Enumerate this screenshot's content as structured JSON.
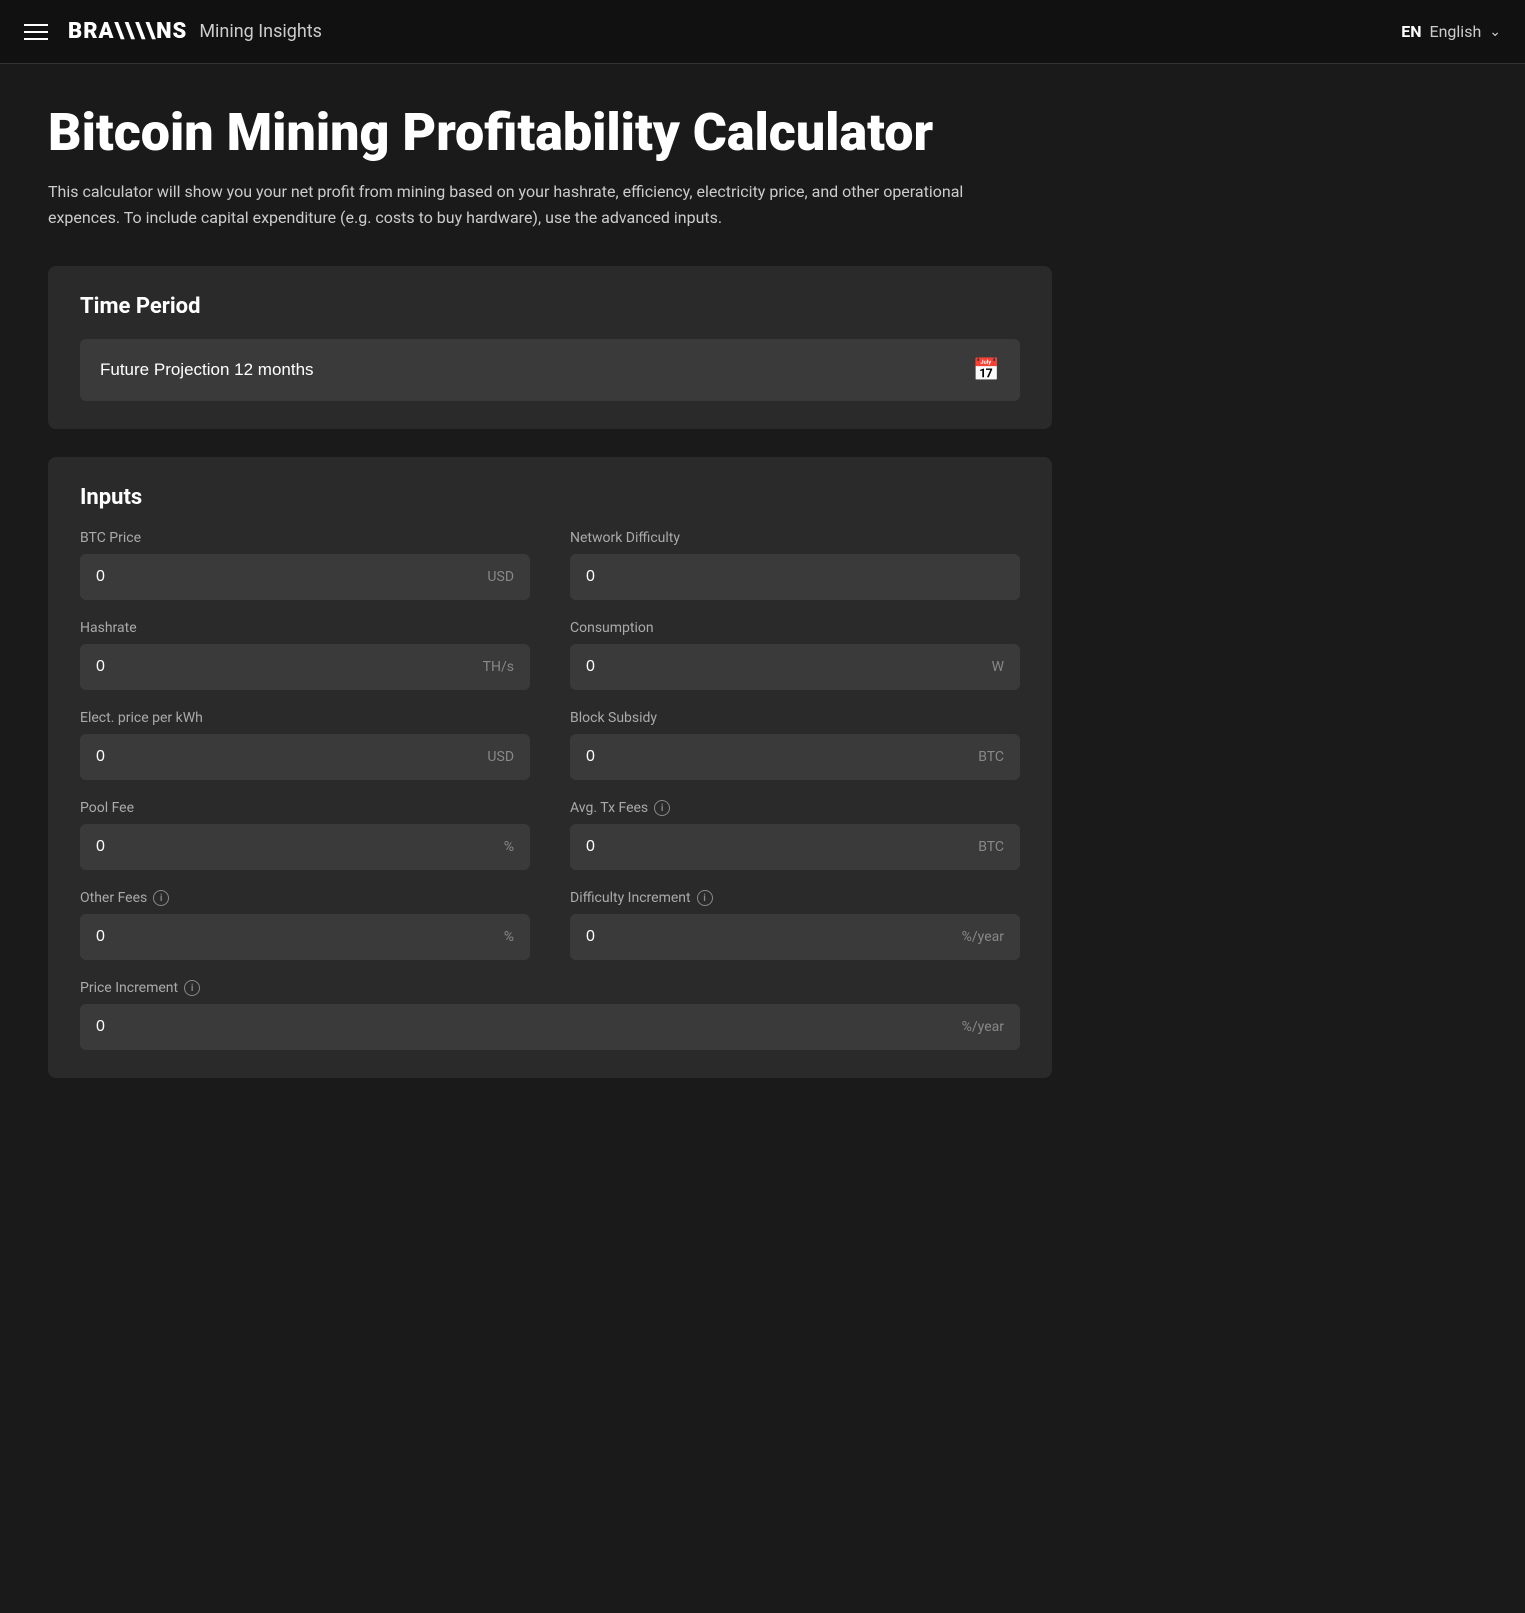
{
  "navbar": {
    "brand_logo": "BRA\\\\NS",
    "brand_subtitle": "Mining Insights",
    "lang_code": "EN",
    "lang_label": "English",
    "menu_icon": "menu"
  },
  "hero": {
    "title": "Bitcoin Mining Profitability Calculator",
    "description": "This calculator will show you your net profit from mining based on your hashrate, efficiency, electricity price, and other operational expences. To include capital expenditure (e.g. costs to buy hardware), use the advanced inputs."
  },
  "time_period": {
    "section_title": "Time Period",
    "selected_value": "Future Projection 12 months",
    "calendar_icon_label": "calendar"
  },
  "inputs": {
    "section_title": "Inputs",
    "fields": [
      {
        "id": "btc-price",
        "label": "BTC Price",
        "value": "0",
        "unit": "USD",
        "has_info": false,
        "full_width": false
      },
      {
        "id": "network-difficulty",
        "label": "Network Difficulty",
        "value": "0",
        "unit": "",
        "has_info": false,
        "full_width": false
      },
      {
        "id": "hashrate",
        "label": "Hashrate",
        "value": "0",
        "unit": "TH/s",
        "has_info": false,
        "full_width": false
      },
      {
        "id": "consumption",
        "label": "Consumption",
        "value": "0",
        "unit": "W",
        "has_info": false,
        "full_width": false
      },
      {
        "id": "elec-price",
        "label": "Elect. price per kWh",
        "value": "0",
        "unit": "USD",
        "has_info": false,
        "full_width": false
      },
      {
        "id": "block-subsidy",
        "label": "Block Subsidy",
        "value": "0",
        "unit": "BTC",
        "has_info": false,
        "full_width": false
      },
      {
        "id": "pool-fee",
        "label": "Pool Fee",
        "value": "0",
        "unit": "%",
        "has_info": false,
        "full_width": false
      },
      {
        "id": "avg-tx-fees",
        "label": "Avg. Tx Fees",
        "value": "0",
        "unit": "BTC",
        "has_info": true,
        "full_width": false
      },
      {
        "id": "other-fees",
        "label": "Other Fees",
        "value": "0",
        "unit": "%",
        "has_info": true,
        "full_width": false
      },
      {
        "id": "difficulty-increment",
        "label": "Difficulty Increment",
        "value": "0",
        "unit": "%/year",
        "has_info": true,
        "full_width": false
      },
      {
        "id": "price-increment",
        "label": "Price Increment",
        "value": "0",
        "unit": "%/year",
        "has_info": true,
        "full_width": true
      }
    ]
  }
}
